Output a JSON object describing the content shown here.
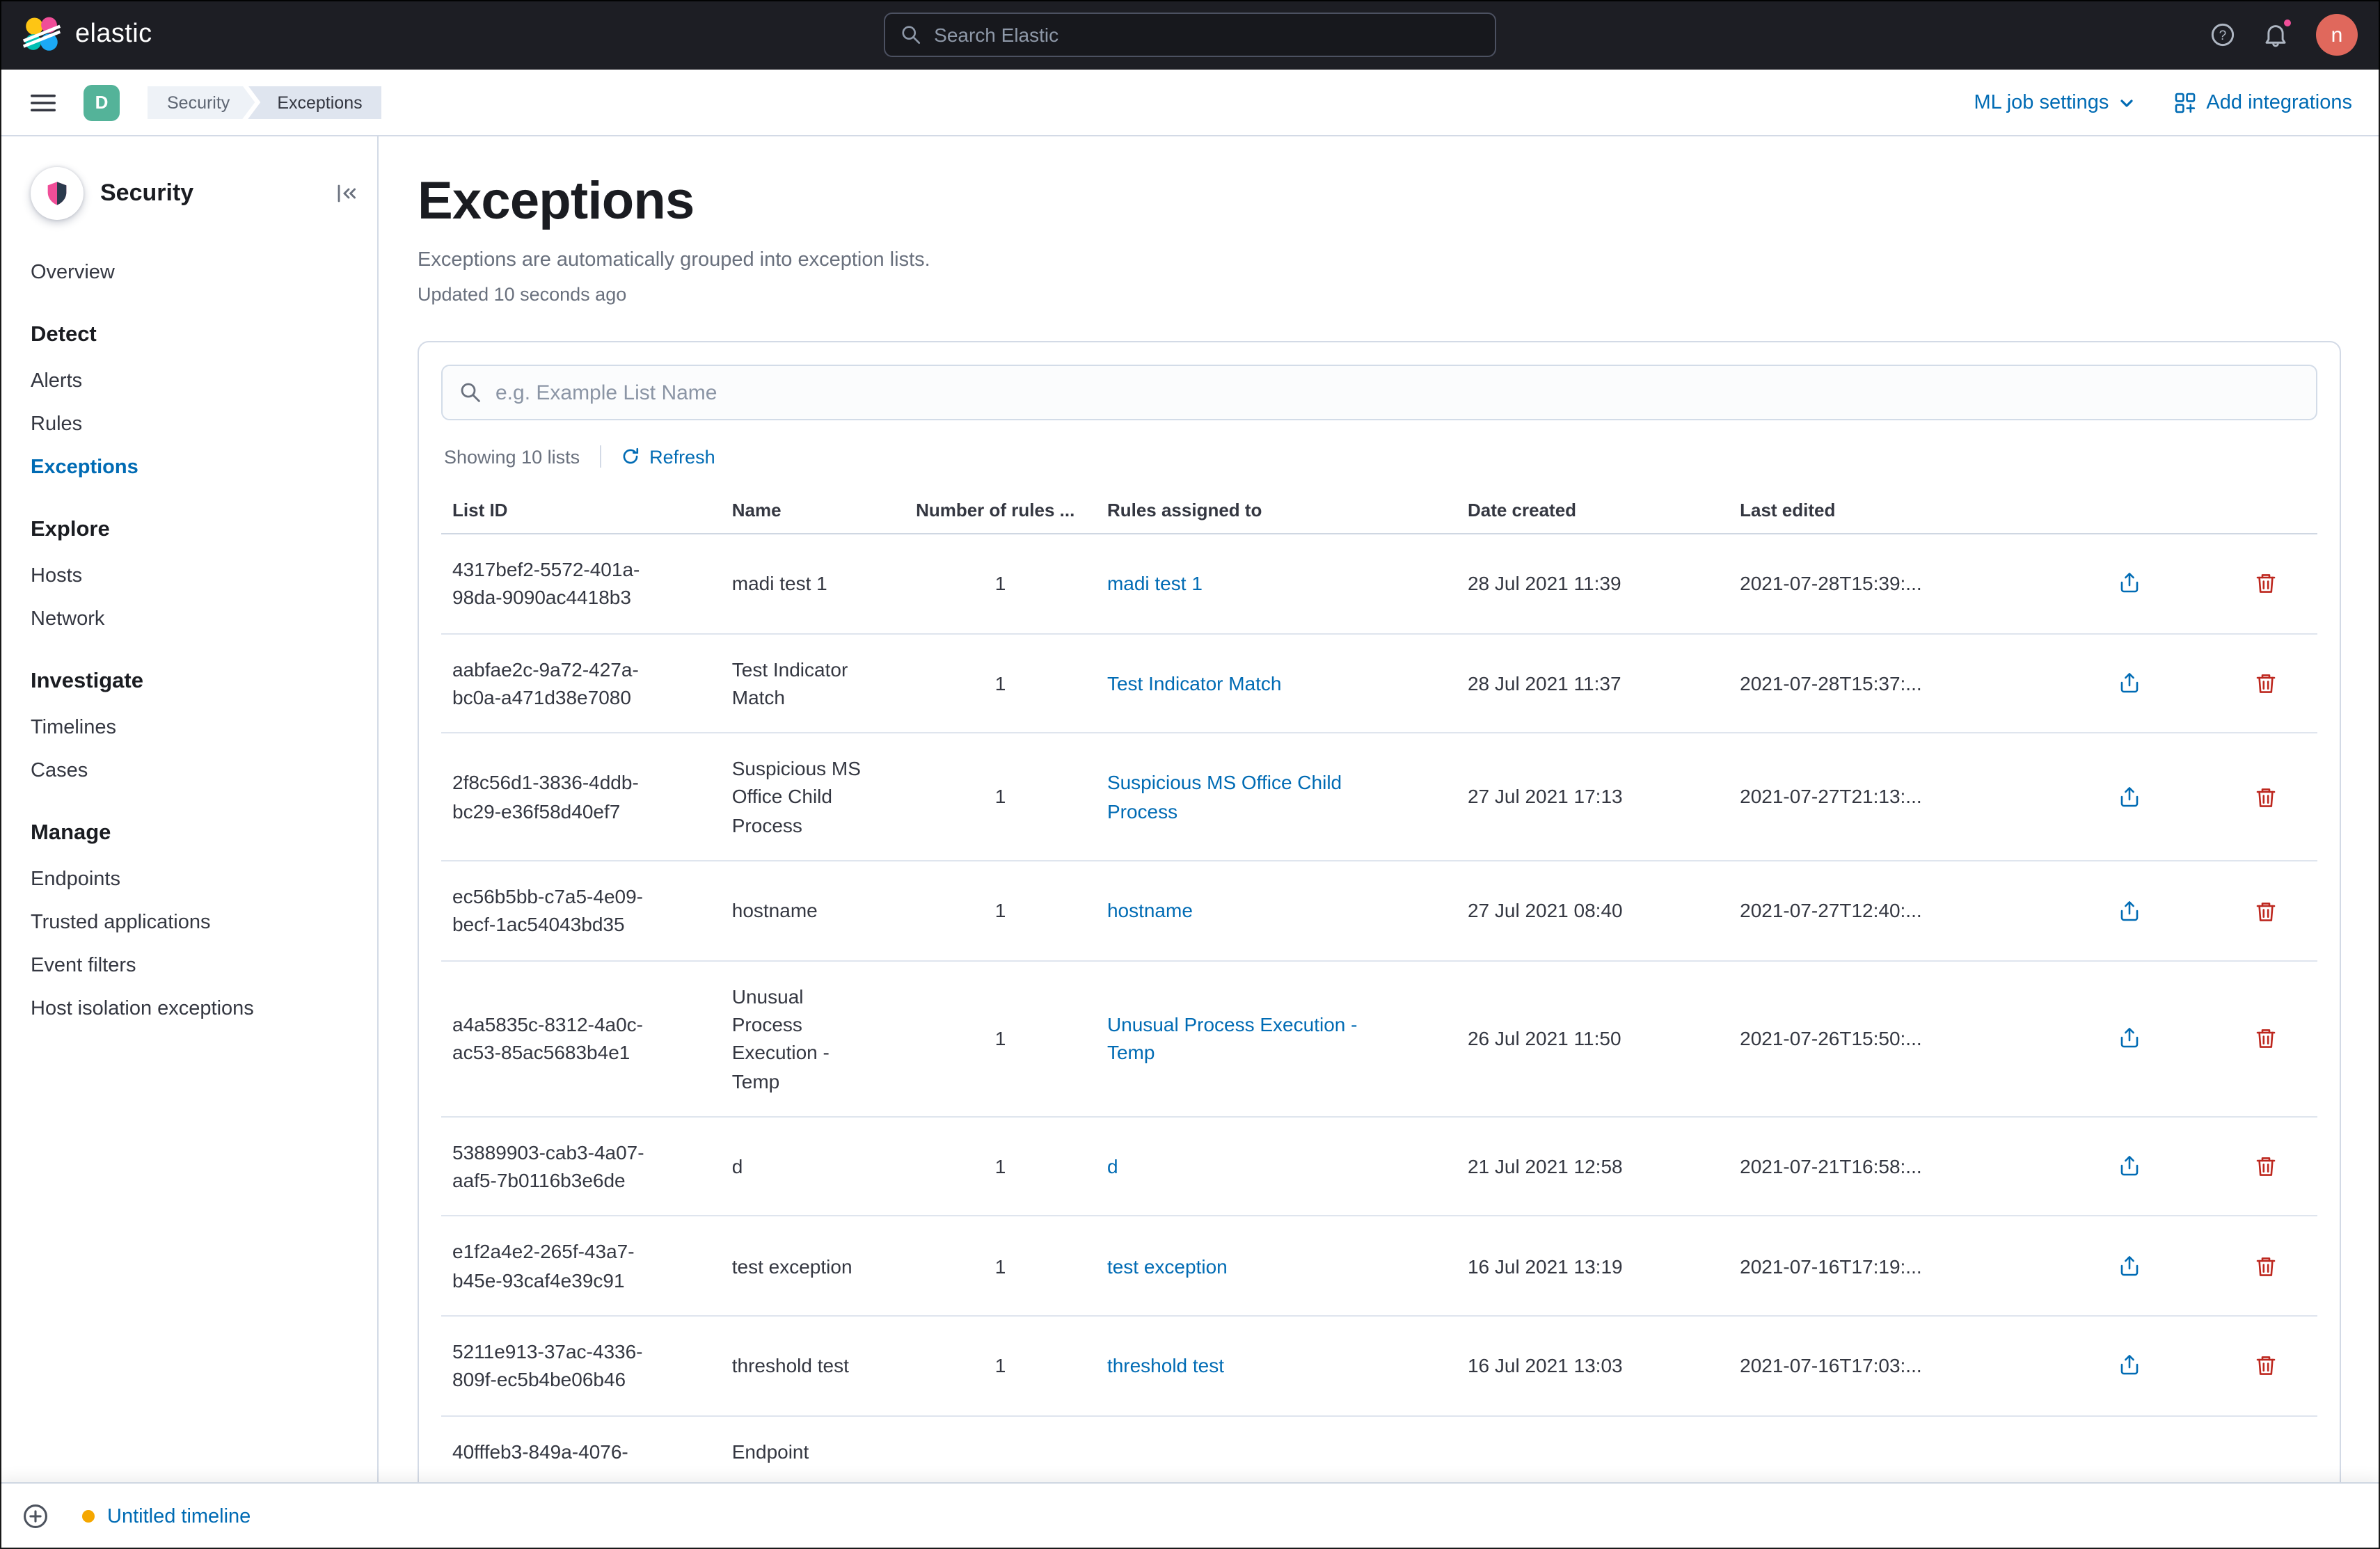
{
  "topbar": {
    "brand": "elastic",
    "search_placeholder": "Search Elastic",
    "user_initial": "n"
  },
  "navbar": {
    "space_initial": "D",
    "breadcrumbs": [
      "Security",
      "Exceptions"
    ],
    "ml_job_settings_label": "ML job settings",
    "add_integrations_label": "Add integrations"
  },
  "sidebar": {
    "app_title": "Security",
    "overview_label": "Overview",
    "active_item": "Exceptions",
    "sections": [
      {
        "title": "Detect",
        "items": [
          "Alerts",
          "Rules",
          "Exceptions"
        ]
      },
      {
        "title": "Explore",
        "items": [
          "Hosts",
          "Network"
        ]
      },
      {
        "title": "Investigate",
        "items": [
          "Timelines",
          "Cases"
        ]
      },
      {
        "title": "Manage",
        "items": [
          "Endpoints",
          "Trusted applications",
          "Event filters",
          "Host isolation exceptions"
        ]
      }
    ]
  },
  "page": {
    "title": "Exceptions",
    "subtitle": "Exceptions are automatically grouped into exception lists.",
    "updated_text": "Updated 10 seconds ago"
  },
  "list_panel": {
    "search_placeholder": "e.g. Example List Name",
    "showing_text": "Showing 10 lists",
    "refresh_label": "Refresh"
  },
  "table": {
    "headers": [
      "List ID",
      "Name",
      "Number of rules ...",
      "Rules assigned to",
      "Date created",
      "Last edited"
    ],
    "rows": [
      {
        "listId": "4317bef2-5572-401a-\n98da-9090ac4418b3",
        "name": "madi test 1",
        "rules": "1",
        "assigned": "madi test 1",
        "created": "28 Jul 2021 11:39",
        "edited": "2021-07-28T15:39:..."
      },
      {
        "listId": "aabfae2c-9a72-427a-\nbc0a-a471d38e7080",
        "name": "Test Indicator\nMatch",
        "rules": "1",
        "assigned": "Test Indicator Match",
        "created": "28 Jul 2021 11:37",
        "edited": "2021-07-28T15:37:..."
      },
      {
        "listId": "2f8c56d1-3836-4ddb-\nbc29-e36f58d40ef7",
        "name": "Suspicious MS\nOffice Child\nProcess",
        "rules": "1",
        "assigned": "Suspicious MS Office Child\nProcess",
        "created": "27 Jul 2021 17:13",
        "edited": "2021-07-27T21:13:..."
      },
      {
        "listId": "ec56b5bb-c7a5-4e09-\nbecf-1ac54043bd35",
        "name": "hostname",
        "rules": "1",
        "assigned": "hostname",
        "created": "27 Jul 2021 08:40",
        "edited": "2021-07-27T12:40:..."
      },
      {
        "listId": "a4a5835c-8312-4a0c-\nac53-85ac5683b4e1",
        "name": "Unusual\nProcess\nExecution -\nTemp",
        "rules": "1",
        "assigned": "Unusual Process Execution -\nTemp",
        "created": "26 Jul 2021 11:50",
        "edited": "2021-07-26T15:50:..."
      },
      {
        "listId": "53889903-cab3-4a07-\naaf5-7b0116b3e6de",
        "name": "d",
        "rules": "1",
        "assigned": "d",
        "created": "21 Jul 2021 12:58",
        "edited": "2021-07-21T16:58:..."
      },
      {
        "listId": "e1f2a4e2-265f-43a7-\nb45e-93caf4e39c91",
        "name": "test exception",
        "rules": "1",
        "assigned": "test exception",
        "created": "16 Jul 2021 13:19",
        "edited": "2021-07-16T17:19:..."
      },
      {
        "listId": "5211e913-37ac-4336-\n809f-ec5b4be06b46",
        "name": "threshold test",
        "rules": "1",
        "assigned": "threshold test",
        "created": "16 Jul 2021 13:03",
        "edited": "2021-07-16T17:03:..."
      },
      {
        "listId": "40fffeb3-849a-4076-",
        "name": "Endpoint",
        "rules": "",
        "assigned": "",
        "created": "",
        "edited": ""
      }
    ]
  },
  "timeline_bar": {
    "title": "Untitled timeline"
  },
  "colors": {
    "header_bg": "#1D1E24",
    "link_blue": "#006BB4",
    "danger_red": "#BD271E",
    "space_badge_green": "#54B399",
    "avatar_salmon": "#E0685C",
    "notification_pink": "#F04E98",
    "timeline_dot_amber": "#F5A700",
    "border_gray": "#D3DAE6"
  }
}
